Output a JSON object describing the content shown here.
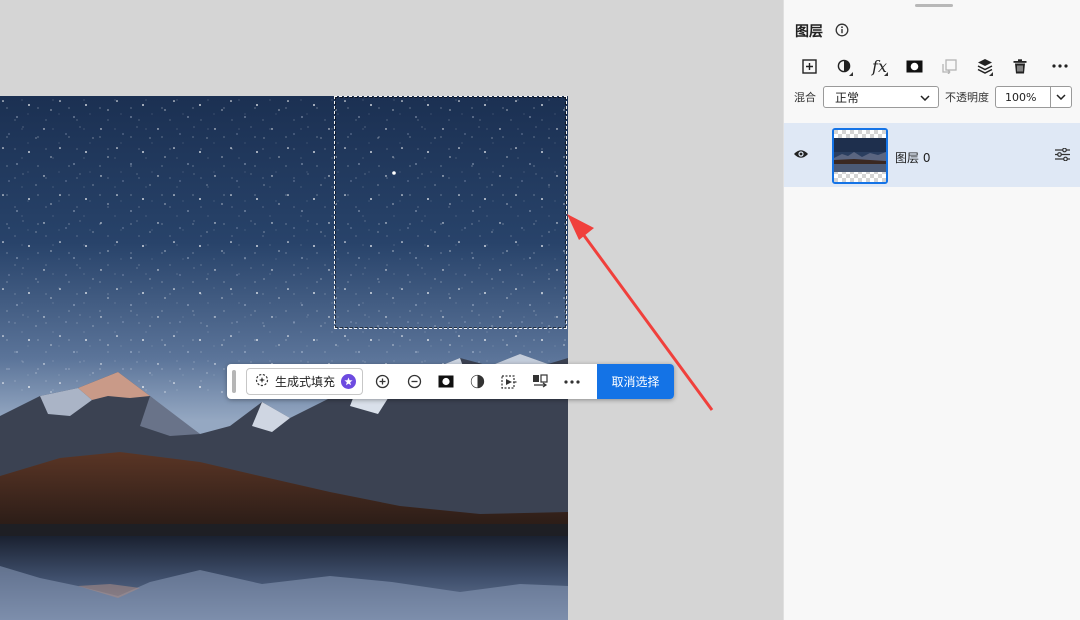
{
  "canvas": {
    "selection": "rectangular-marquee"
  },
  "taskbar": {
    "generative_fill_label": "生成式填充",
    "deselect_label": "取消选择",
    "icons": [
      "star-badge-icon",
      "add-to-selection-icon",
      "subtract-selection-icon",
      "mask-icon",
      "adjustment-icon",
      "transform-selection-icon",
      "invert-selection-icon",
      "more-icon"
    ]
  },
  "layers_panel": {
    "title": "图层",
    "blend_label": "混合",
    "blend_mode": "正常",
    "opacity_label": "不透明度",
    "opacity_value": "100%",
    "toolbar_icons": [
      "add-layer-icon",
      "adjustment-layer-icon",
      "fx-icon",
      "mask-icon",
      "clipping-mask-icon",
      "stack-icon",
      "trash-icon",
      "more-icon"
    ],
    "fx_text": "fx",
    "layers": [
      {
        "name": "图层 0",
        "visible": true,
        "selected": true
      }
    ]
  },
  "colors": {
    "accent": "#1473e6",
    "selected_row": "#dfe8f5",
    "annotation_arrow": "#f0403c",
    "badge_purple": "#6d4be0"
  }
}
